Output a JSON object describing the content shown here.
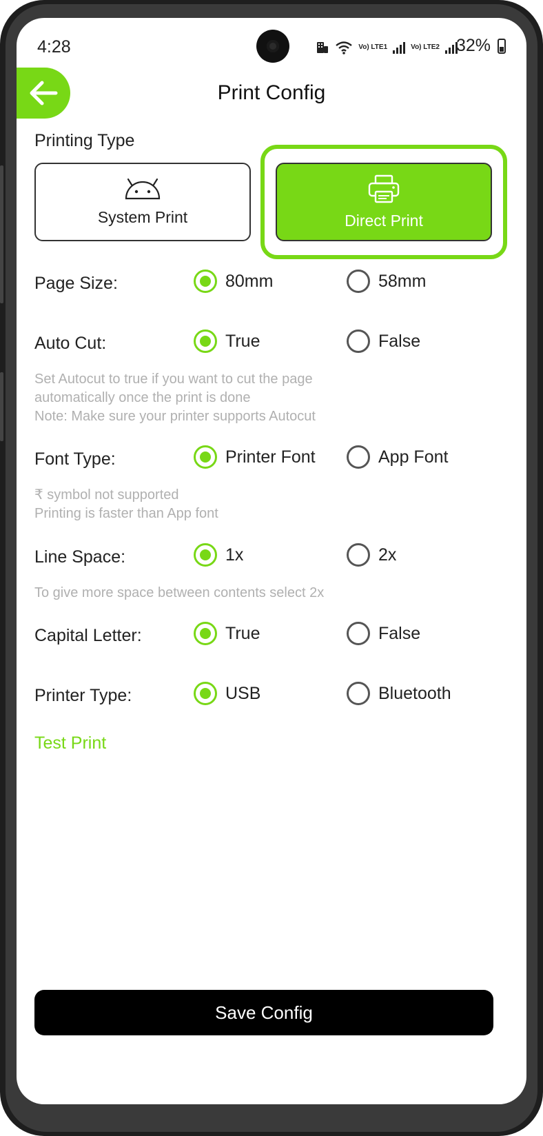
{
  "status_bar": {
    "time": "4:28",
    "lte1": "Vo) LTE1",
    "lte2": "Vo) LTE2",
    "battery": "32%"
  },
  "header": {
    "title": "Print Config",
    "back_icon": "arrow-left-icon"
  },
  "printing_type": {
    "label": "Printing Type",
    "options": [
      {
        "label": "System Print",
        "icon": "android-icon",
        "selected": false
      },
      {
        "label": "Direct Print",
        "icon": "printer-icon",
        "selected": true
      }
    ]
  },
  "settings": {
    "page_size": {
      "label": "Page Size:",
      "options": [
        "80mm",
        "58mm"
      ],
      "selected": "80mm"
    },
    "auto_cut": {
      "label": "Auto Cut:",
      "options": [
        "True",
        "False"
      ],
      "selected": "True"
    },
    "auto_cut_help": [
      "Set Autocut to true if you want to cut the page",
      "automatically once the print is done",
      "Note: Make sure your printer supports Autocut"
    ],
    "font_type": {
      "label": "Font Type:",
      "options": [
        "Printer Font",
        "App Font"
      ],
      "selected": "Printer Font"
    },
    "font_type_help": [
      "₹ symbol not supported",
      "Printing is faster than App font"
    ],
    "line_space": {
      "label": "Line Space:",
      "options": [
        "1x",
        "2x"
      ],
      "selected": "1x"
    },
    "line_space_help": "To give more space between contents select 2x",
    "capital_letter": {
      "label": "Capital Letter:",
      "options": [
        "True",
        "False"
      ],
      "selected": "True"
    },
    "printer_type": {
      "label": "Printer Type:",
      "options": [
        "USB",
        "Bluetooth"
      ],
      "selected": "USB"
    }
  },
  "test_print": "Test Print",
  "save_button": "Save Config",
  "colors": {
    "accent": "#78d816",
    "text": "#222222",
    "help_text": "#b0b0b0",
    "save_bg": "#000000"
  }
}
